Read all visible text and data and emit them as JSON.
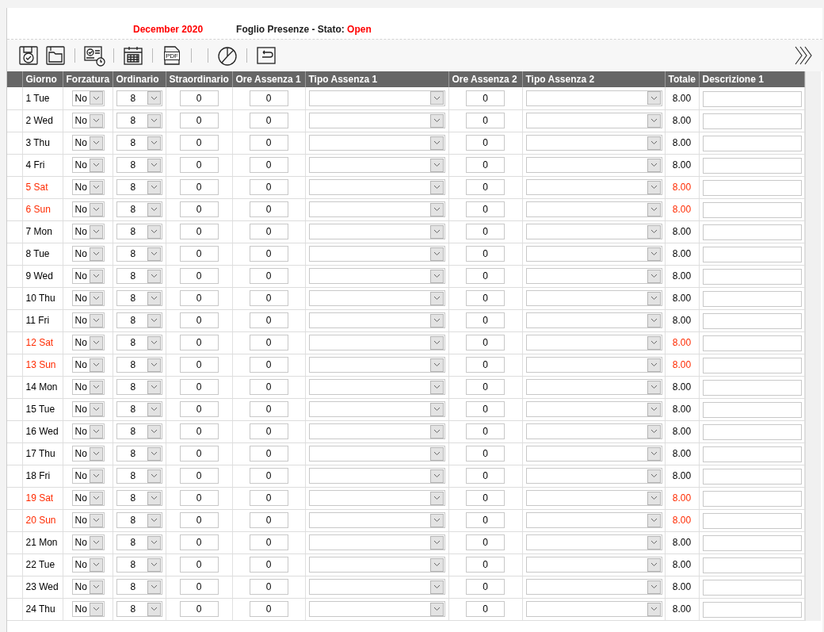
{
  "header": {
    "period": "December 2020",
    "sheet_label": "Foglio Presenze - Stato:",
    "status": "Open"
  },
  "toolbar": {
    "pdf_label": "PDF"
  },
  "table": {
    "columns": [
      "Giorno",
      "Forzatura",
      "Ordinario",
      "Straordinario",
      "Ore Assenza 1",
      "Tipo Assenza 1",
      "Ore Assenza 2",
      "Tipo Assenza 2",
      "Totale",
      "Descrizione 1"
    ],
    "rows": [
      {
        "day": "1 Tue",
        "weekend": false,
        "forzatura": "No",
        "ordinario": "8",
        "straordinario": "0",
        "ore_assenza_1": "0",
        "ore_assenza_2": "0",
        "totale": "8.00"
      },
      {
        "day": "2 Wed",
        "weekend": false,
        "forzatura": "No",
        "ordinario": "8",
        "straordinario": "0",
        "ore_assenza_1": "0",
        "ore_assenza_2": "0",
        "totale": "8.00"
      },
      {
        "day": "3 Thu",
        "weekend": false,
        "forzatura": "No",
        "ordinario": "8",
        "straordinario": "0",
        "ore_assenza_1": "0",
        "ore_assenza_2": "0",
        "totale": "8.00"
      },
      {
        "day": "4 Fri",
        "weekend": false,
        "forzatura": "No",
        "ordinario": "8",
        "straordinario": "0",
        "ore_assenza_1": "0",
        "ore_assenza_2": "0",
        "totale": "8.00"
      },
      {
        "day": "5 Sat",
        "weekend": true,
        "forzatura": "No",
        "ordinario": "8",
        "straordinario": "0",
        "ore_assenza_1": "0",
        "ore_assenza_2": "0",
        "totale": "8.00"
      },
      {
        "day": "6 Sun",
        "weekend": true,
        "forzatura": "No",
        "ordinario": "8",
        "straordinario": "0",
        "ore_assenza_1": "0",
        "ore_assenza_2": "0",
        "totale": "8.00"
      },
      {
        "day": "7 Mon",
        "weekend": false,
        "forzatura": "No",
        "ordinario": "8",
        "straordinario": "0",
        "ore_assenza_1": "0",
        "ore_assenza_2": "0",
        "totale": "8.00"
      },
      {
        "day": "8 Tue",
        "weekend": false,
        "forzatura": "No",
        "ordinario": "8",
        "straordinario": "0",
        "ore_assenza_1": "0",
        "ore_assenza_2": "0",
        "totale": "8.00"
      },
      {
        "day": "9 Wed",
        "weekend": false,
        "forzatura": "No",
        "ordinario": "8",
        "straordinario": "0",
        "ore_assenza_1": "0",
        "ore_assenza_2": "0",
        "totale": "8.00"
      },
      {
        "day": "10 Thu",
        "weekend": false,
        "forzatura": "No",
        "ordinario": "8",
        "straordinario": "0",
        "ore_assenza_1": "0",
        "ore_assenza_2": "0",
        "totale": "8.00"
      },
      {
        "day": "11 Fri",
        "weekend": false,
        "forzatura": "No",
        "ordinario": "8",
        "straordinario": "0",
        "ore_assenza_1": "0",
        "ore_assenza_2": "0",
        "totale": "8.00"
      },
      {
        "day": "12 Sat",
        "weekend": true,
        "forzatura": "No",
        "ordinario": "8",
        "straordinario": "0",
        "ore_assenza_1": "0",
        "ore_assenza_2": "0",
        "totale": "8.00"
      },
      {
        "day": "13 Sun",
        "weekend": true,
        "forzatura": "No",
        "ordinario": "8",
        "straordinario": "0",
        "ore_assenza_1": "0",
        "ore_assenza_2": "0",
        "totale": "8.00"
      },
      {
        "day": "14 Mon",
        "weekend": false,
        "forzatura": "No",
        "ordinario": "8",
        "straordinario": "0",
        "ore_assenza_1": "0",
        "ore_assenza_2": "0",
        "totale": "8.00"
      },
      {
        "day": "15 Tue",
        "weekend": false,
        "forzatura": "No",
        "ordinario": "8",
        "straordinario": "0",
        "ore_assenza_1": "0",
        "ore_assenza_2": "0",
        "totale": "8.00"
      },
      {
        "day": "16 Wed",
        "weekend": false,
        "forzatura": "No",
        "ordinario": "8",
        "straordinario": "0",
        "ore_assenza_1": "0",
        "ore_assenza_2": "0",
        "totale": "8.00"
      },
      {
        "day": "17 Thu",
        "weekend": false,
        "forzatura": "No",
        "ordinario": "8",
        "straordinario": "0",
        "ore_assenza_1": "0",
        "ore_assenza_2": "0",
        "totale": "8.00"
      },
      {
        "day": "18 Fri",
        "weekend": false,
        "forzatura": "No",
        "ordinario": "8",
        "straordinario": "0",
        "ore_assenza_1": "0",
        "ore_assenza_2": "0",
        "totale": "8.00"
      },
      {
        "day": "19 Sat",
        "weekend": true,
        "forzatura": "No",
        "ordinario": "8",
        "straordinario": "0",
        "ore_assenza_1": "0",
        "ore_assenza_2": "0",
        "totale": "8.00"
      },
      {
        "day": "20 Sun",
        "weekend": true,
        "forzatura": "No",
        "ordinario": "8",
        "straordinario": "0",
        "ore_assenza_1": "0",
        "ore_assenza_2": "0",
        "totale": "8.00"
      },
      {
        "day": "21 Mon",
        "weekend": false,
        "forzatura": "No",
        "ordinario": "8",
        "straordinario": "0",
        "ore_assenza_1": "0",
        "ore_assenza_2": "0",
        "totale": "8.00"
      },
      {
        "day": "22 Tue",
        "weekend": false,
        "forzatura": "No",
        "ordinario": "8",
        "straordinario": "0",
        "ore_assenza_1": "0",
        "ore_assenza_2": "0",
        "totale": "8.00"
      },
      {
        "day": "23 Wed",
        "weekend": false,
        "forzatura": "No",
        "ordinario": "8",
        "straordinario": "0",
        "ore_assenza_1": "0",
        "ore_assenza_2": "0",
        "totale": "8.00"
      },
      {
        "day": "24 Thu",
        "weekend": false,
        "forzatura": "No",
        "ordinario": "8",
        "straordinario": "0",
        "ore_assenza_1": "0",
        "ore_assenza_2": "0",
        "totale": "8.00"
      }
    ]
  }
}
